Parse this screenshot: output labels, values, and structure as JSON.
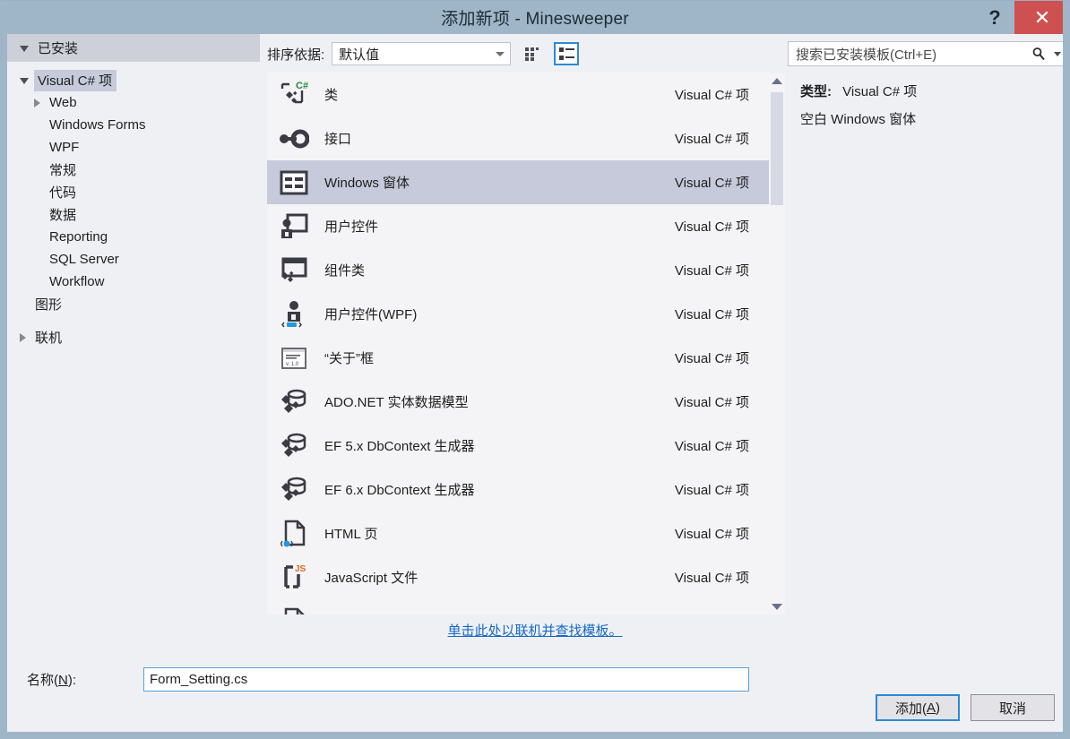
{
  "window": {
    "title": "添加新项 - Minesweeper",
    "help_label": "?",
    "close_label": "✕",
    "accent_color": "#9fb6c8",
    "close_color": "#cf5050"
  },
  "tree": {
    "header": "已安装",
    "items": [
      {
        "label": "Visual C# 项",
        "depth": 0,
        "expander": "down",
        "selected": true
      },
      {
        "label": "Web",
        "depth": 1,
        "expander": "right",
        "selected": false
      },
      {
        "label": "Windows Forms",
        "depth": 1,
        "expander": "none",
        "selected": false
      },
      {
        "label": "WPF",
        "depth": 1,
        "expander": "none",
        "selected": false
      },
      {
        "label": "常规",
        "depth": 1,
        "expander": "none",
        "selected": false
      },
      {
        "label": "代码",
        "depth": 1,
        "expander": "none",
        "selected": false
      },
      {
        "label": "数据",
        "depth": 1,
        "expander": "none",
        "selected": false
      },
      {
        "label": "Reporting",
        "depth": 1,
        "expander": "none",
        "selected": false
      },
      {
        "label": "SQL Server",
        "depth": 1,
        "expander": "none",
        "selected": false
      },
      {
        "label": "Workflow",
        "depth": 1,
        "expander": "none",
        "selected": false
      },
      {
        "label": "图形",
        "depth": 0,
        "expander": "none",
        "selected": false
      },
      {
        "label": "联机",
        "depth": 0,
        "expander": "right",
        "selected": false
      }
    ]
  },
  "toolbar": {
    "sort_label": "排序依据:",
    "sort_value": "默认值",
    "view_tiles_name": "medium-icons-view",
    "view_list_name": "list-view",
    "view_selected": "list"
  },
  "search": {
    "placeholder": "搜索已安装模板(Ctrl+E)",
    "value": ""
  },
  "templates": {
    "kind_column": "Visual C# 项",
    "items": [
      {
        "name": "类",
        "kind": "Visual C# 项",
        "icon": "class-icon",
        "selected": false
      },
      {
        "name": "接口",
        "kind": "Visual C# 项",
        "icon": "interface-icon",
        "selected": false
      },
      {
        "name": "Windows 窗体",
        "kind": "Visual C# 项",
        "icon": "windows-form-icon",
        "selected": true
      },
      {
        "name": "用户控件",
        "kind": "Visual C# 项",
        "icon": "user-control-icon",
        "selected": false
      },
      {
        "name": "组件类",
        "kind": "Visual C# 项",
        "icon": "component-class-icon",
        "selected": false
      },
      {
        "name": "用户控件(WPF)",
        "kind": "Visual C# 项",
        "icon": "wpf-user-control-icon",
        "selected": false
      },
      {
        "name": "“关于”框",
        "kind": "Visual C# 项",
        "icon": "about-box-icon",
        "selected": false
      },
      {
        "name": "ADO.NET 实体数据模型",
        "kind": "Visual C# 项",
        "icon": "ado-entity-model-icon",
        "selected": false
      },
      {
        "name": "EF 5.x DbContext 生成器",
        "kind": "Visual C# 项",
        "icon": "ado-entity-model-icon",
        "selected": false
      },
      {
        "name": "EF 6.x DbContext 生成器",
        "kind": "Visual C# 项",
        "icon": "ado-entity-model-icon",
        "selected": false
      },
      {
        "name": "HTML 页",
        "kind": "Visual C# 项",
        "icon": "html-page-icon",
        "selected": false
      },
      {
        "name": "JavaScript 文件",
        "kind": "Visual C# 项",
        "icon": "javascript-file-icon",
        "selected": false
      }
    ],
    "about_box_version_text": "v. 1.0"
  },
  "details": {
    "type_key": "类型:",
    "type_value": "Visual C# 项",
    "description": "空白 Windows 窗体"
  },
  "online_link": "单击此处以联机并查找模板。",
  "name_field": {
    "label_prefix": "名称(",
    "label_accel": "N",
    "label_suffix": "):",
    "value": "Form_Setting.cs"
  },
  "buttons": {
    "add_prefix": "添加(",
    "add_accel": "A",
    "add_suffix": ")",
    "cancel": "取消"
  }
}
